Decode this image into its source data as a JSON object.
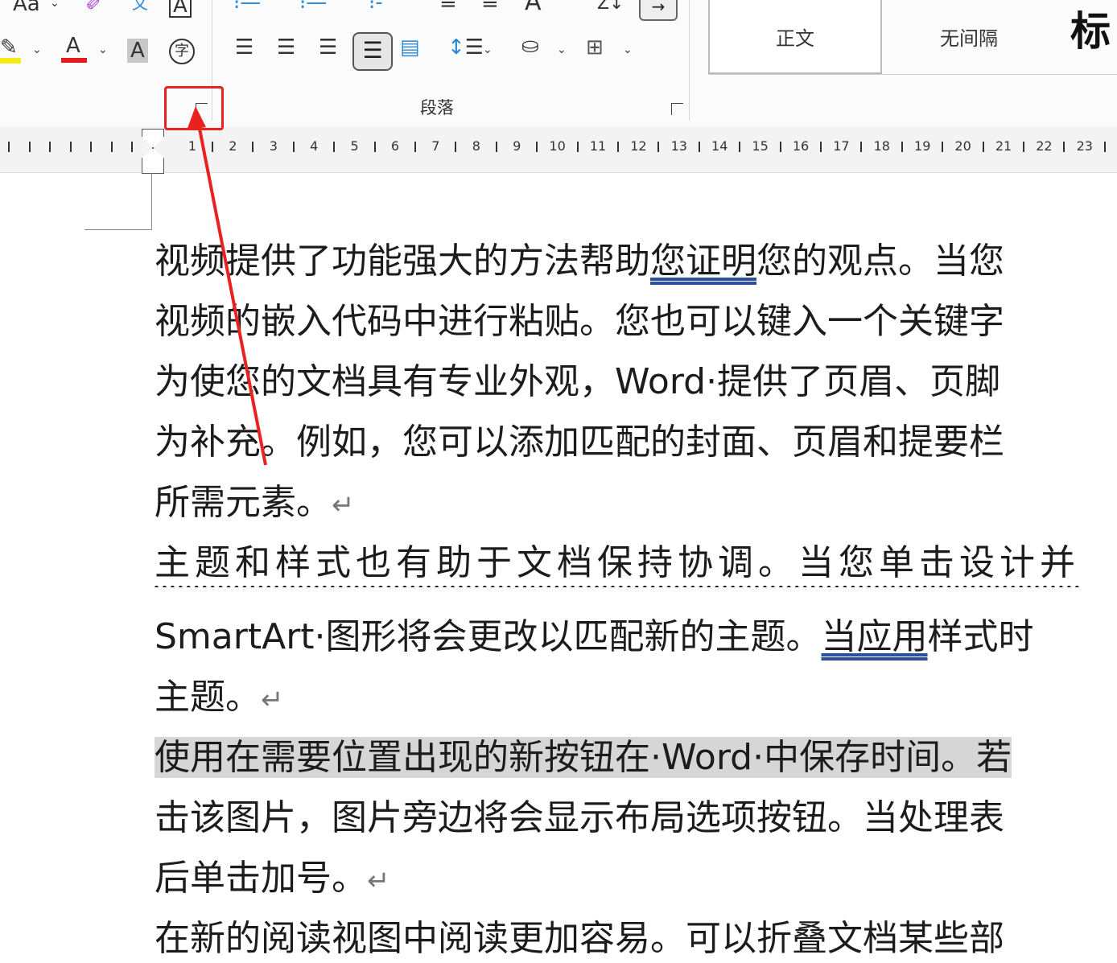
{
  "ribbon": {
    "font_group": {
      "change_case": "Aa",
      "clear_format_icon": "eraser",
      "phonetic": "文",
      "char_border": "A",
      "font_color": "A",
      "char_shading": "A",
      "enclose": "字",
      "highlight_color": "#f5ea14",
      "font_color_value": "#e31b1b"
    },
    "paragraph_group": {
      "label": "段落",
      "sort": "Z↓"
    },
    "styles": [
      {
        "label": "正文"
      },
      {
        "label": "无间隔"
      },
      {
        "label": "标"
      }
    ]
  },
  "ruler": {
    "numbers": [
      "1",
      "2",
      "3",
      "4",
      "5",
      "6",
      "7",
      "8",
      "9",
      "10",
      "11",
      "12",
      "13",
      "14",
      "15",
      "16",
      "17",
      "18",
      "19",
      "20",
      "21",
      "22",
      "23"
    ]
  },
  "annotation": {
    "color": "#e8231f"
  },
  "document": {
    "lines": [
      {
        "a": "视频提供了功能强大的方法帮助",
        "u": "您证明",
        "b": "您的观点。当您"
      },
      {
        "a": "视频的嵌入代码中进行粘贴。您也可以键入一个关键字"
      },
      {
        "a": "为使您的文档具有专业外观，Word·提供了页眉、页脚"
      },
      {
        "a": "为补充。例如，您可以添加匹配的封面、页眉和提要栏"
      },
      {
        "a": "所需元素。",
        "pm": "↵"
      },
      {
        "a": "主题和样式也有助于文档保持协调。当您单击设计并"
      },
      {
        "a": "SmartArt·图形将会更改以匹配新的主题。",
        "u": "当应用",
        "b": "样式时"
      },
      {
        "a": "主题。",
        "pm": "↵"
      },
      {
        "a": "使用在需要位置出现的新按钮在·Word·中保存时间。若"
      },
      {
        "a": "击该图片，图片旁边将会显示布局选项按钮。当处理表"
      },
      {
        "a": "后单击加号。",
        "pm": "↵"
      },
      {
        "a": "在新的阅读视图中阅读更加容易。可以折叠文档某些部"
      }
    ]
  }
}
